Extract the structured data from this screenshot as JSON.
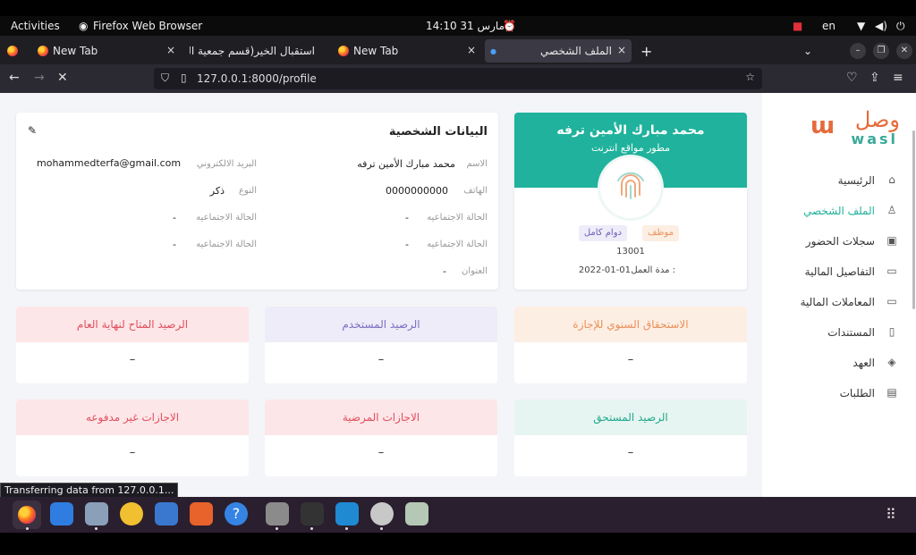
{
  "topbar": {
    "activities": "Activities",
    "app": "Firefox Web Browser",
    "clock": "14:10  31 مارس",
    "lang": "en"
  },
  "tabs": [
    {
      "label": "New Tab",
      "close": "×"
    },
    {
      "label": "استقبال الخير(قسم جمعية الدع",
      "close": "×"
    },
    {
      "label": "New Tab",
      "close": "×"
    },
    {
      "label": "الملف الشخصي",
      "close": "×"
    }
  ],
  "new_tab": "+",
  "url": "127.0.0.1:8000/profile",
  "sidebar": {
    "logo_ar": "وصل",
    "logo_en": "wasl",
    "items": [
      {
        "label": "الرئيسية",
        "icon": "home-icon",
        "glyph": "⌂"
      },
      {
        "label": "الملف الشخصي",
        "icon": "user-icon",
        "glyph": "♙"
      },
      {
        "label": "سجلات الحضور",
        "icon": "calendar-check-icon",
        "glyph": "▣"
      },
      {
        "label": "التفاصيل المالية",
        "icon": "card-icon",
        "glyph": "▭"
      },
      {
        "label": "المعاملات المالية",
        "icon": "card-icon",
        "glyph": "▭"
      },
      {
        "label": "المستندات",
        "icon": "document-icon",
        "glyph": "▯"
      },
      {
        "label": "العهد",
        "icon": "box-icon",
        "glyph": "◈"
      },
      {
        "label": "الطلبات",
        "icon": "clipboard-icon",
        "glyph": "▤"
      }
    ]
  },
  "profile": {
    "name": "محمد مبارك الأمين ترفه",
    "title": "مطور مواقع انترنت",
    "badge_status": "موظف",
    "badge_type": "دوام كامل",
    "id": "13001",
    "work_period_label": "مدة العمل :",
    "work_period_value": "2022-01-01"
  },
  "personal": {
    "heading": "البيانات الشخصية",
    "name_label": "الاسم",
    "name_value": "محمد مبارك الأمين ترفه",
    "email_label": "البريد الالكتروني",
    "email_value": "mohammedterfa@gmail.com",
    "phone_label": "الهاتف",
    "phone_value": "0000000000",
    "gender_label": "النوع",
    "gender_value": "ذكر",
    "social1_label": "الحالة الاجتماعيه",
    "social1_value": "-",
    "social2_label": "الحالة الاجتماعيه",
    "social2_value": "-",
    "social3_label": "الحالة الاجتماعيه",
    "social3_value": "-",
    "social4_label": "الحالة الاجتماعيه",
    "social4_value": "-",
    "address_label": "العنوان",
    "address_value": "-"
  },
  "stats": [
    {
      "label": "الاستحقاق السنوي للإجازة",
      "value": "–",
      "bg": "#fdeee3",
      "fg": "#e9905a"
    },
    {
      "label": "الرصيد المستخدم",
      "value": "–",
      "bg": "#eeecf8",
      "fg": "#7b6fc4"
    },
    {
      "label": "الرصيد المتاح لنهاية العام",
      "value": "–",
      "bg": "#fde6e8",
      "fg": "#e0505e"
    },
    {
      "label": "الرصيد المستحق",
      "value": "–",
      "bg": "#e6f5f1",
      "fg": "#22a88e"
    },
    {
      "label": "الاجازات المرضية",
      "value": "–",
      "bg": "#fde6e8",
      "fg": "#e0505e"
    },
    {
      "label": "الاجازات غير مدفوعه",
      "value": "–",
      "bg": "#fde6e8",
      "fg": "#e0505e"
    }
  ],
  "status_text": "Transferring data from 127.0.0.1...",
  "colors": {
    "teal": "#20b29c",
    "orange": "#e56b3a"
  }
}
